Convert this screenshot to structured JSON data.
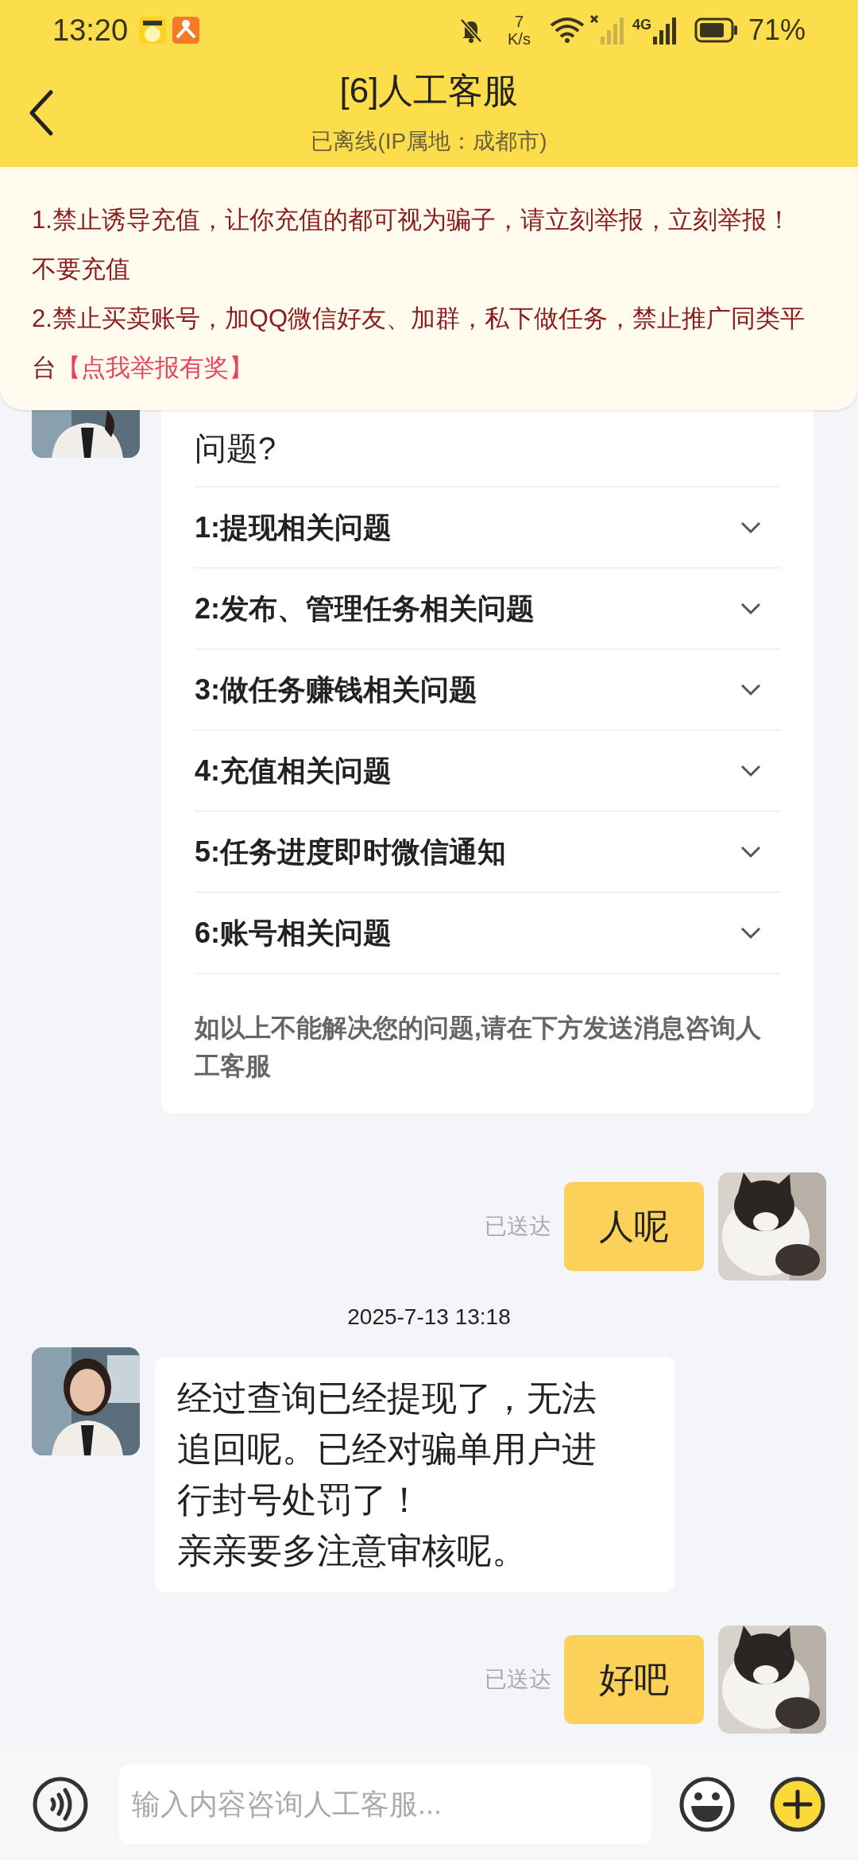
{
  "status_bar": {
    "time": "13:20",
    "net_speed_value": "7",
    "net_speed_unit": "K/s",
    "network": "4G",
    "battery": "71%"
  },
  "header": {
    "title": "[6]人工客服",
    "subtitle": "已离线(IP属地：成都市)"
  },
  "notice": {
    "lines": [
      "1.禁止诱导充值，让你充值的都可视为骗子，请立刻举报，立刻举报！不要充值",
      "2.禁止买卖账号，加QQ微信好友、加群，私下做任务，禁止推广同类平台"
    ],
    "link": "【点我举报有奖】"
  },
  "messages": [
    {
      "kind": "faq",
      "intro": "问题?",
      "items": [
        {
          "label": "1:提现相关问题",
          "expanded": false
        },
        {
          "label": "2:发布、管理任务相关问题",
          "expanded": false
        },
        {
          "label": "3:做任务赚钱相关问题",
          "expanded": false
        },
        {
          "label": "4:充值相关问题",
          "expanded": false
        },
        {
          "label": "5:任务进度即时微信通知",
          "expanded": false
        },
        {
          "label": "6:账号相关问题",
          "expanded": false
        }
      ],
      "footer": "如以上不能解决您的问题,请在下方发送消息咨询人工客服"
    },
    {
      "kind": "sent",
      "text": "人呢",
      "status": "已送达"
    },
    {
      "kind": "time",
      "text": "2025-7-13 13:18"
    },
    {
      "kind": "received",
      "lines": [
        "经过查询已经提现了，无法追回呢。已经对骗单用户进行封号处罚了！",
        "亲亲要多注意审核呢。"
      ]
    },
    {
      "kind": "sent",
      "text": "好吧",
      "status": "已送达"
    }
  ],
  "composer": {
    "placeholder": "输入内容咨询人工客服..."
  }
}
